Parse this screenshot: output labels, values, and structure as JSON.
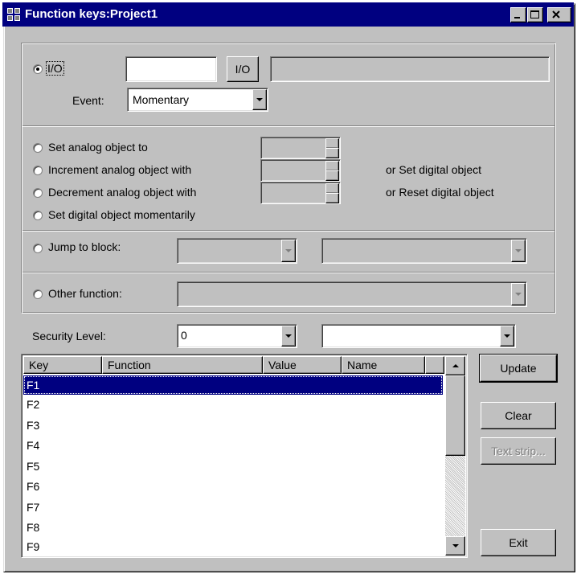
{
  "window": {
    "title": "Function keys:Project1"
  },
  "io": {
    "radio_label": "I/O",
    "input_value": "",
    "io_button_label": "I/O",
    "io_display_value": "",
    "event_label": "Event:",
    "event_value": "Momentary"
  },
  "actions": {
    "set_analog": "Set analog object to",
    "increment_analog": "Increment analog object with",
    "decrement_analog": "Decrement analog object with",
    "set_digital_momentarily": "Set digital object momentarily",
    "or_set_digital": "or Set digital object",
    "or_reset_digital": "or Reset digital object"
  },
  "jump": {
    "label": "Jump to block:"
  },
  "other": {
    "label": "Other function:"
  },
  "security": {
    "label": "Security Level:",
    "value": "0",
    "name_value": ""
  },
  "list": {
    "columns": [
      "Key",
      "Function",
      "Value",
      "Name"
    ],
    "rows": [
      "F1",
      "F2",
      "F3",
      "F4",
      "F5",
      "F6",
      "F7",
      "F8",
      "F9"
    ],
    "selected_index": 0
  },
  "buttons": {
    "update": "Update",
    "clear": "Clear",
    "text_strip": "Text strip...",
    "exit": "Exit"
  }
}
